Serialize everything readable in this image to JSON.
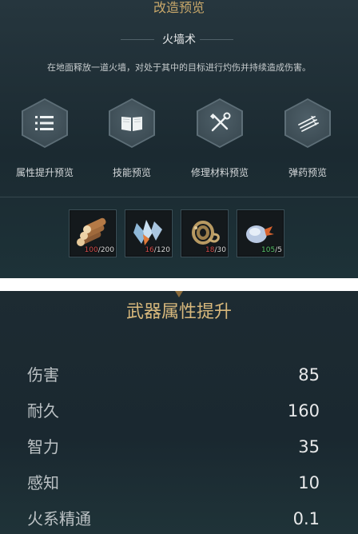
{
  "upgrade_panel": {
    "title": "改造预览",
    "skill_name": "火墙术",
    "description": "在地面释放一道火墙，对处于其中的目标进行灼伤并持续造成伤害。",
    "actions": [
      {
        "label": "属性提升预览",
        "icon": "list-icon"
      },
      {
        "label": "技能预览",
        "icon": "book-icon"
      },
      {
        "label": "修理材料预览",
        "icon": "repair-tools-icon"
      },
      {
        "label": "弹药预览",
        "icon": "arrows-icon"
      }
    ],
    "materials": [
      {
        "icon": "wood-logs-icon",
        "have": "100",
        "need": "200",
        "sufficient": false
      },
      {
        "icon": "crystal-shards-icon",
        "have": "16",
        "need": "120",
        "sufficient": false
      },
      {
        "icon": "rope-coil-icon",
        "have": "18",
        "need": "30",
        "sufficient": false
      },
      {
        "icon": "blue-ore-icon",
        "have": "105",
        "need": "5",
        "sufficient": true
      }
    ]
  },
  "stats_panel": {
    "title": "武器属性提升",
    "stats": [
      {
        "name": "伤害",
        "value": "85"
      },
      {
        "name": "耐久",
        "value": "160"
      },
      {
        "name": "智力",
        "value": "35"
      },
      {
        "name": "感知",
        "value": "10"
      },
      {
        "name": "火系精通",
        "value": "0.1"
      }
    ]
  },
  "colors": {
    "gold_title": "#c9a86a",
    "insufficient": "#d24a48",
    "sufficient": "#58c56a"
  }
}
